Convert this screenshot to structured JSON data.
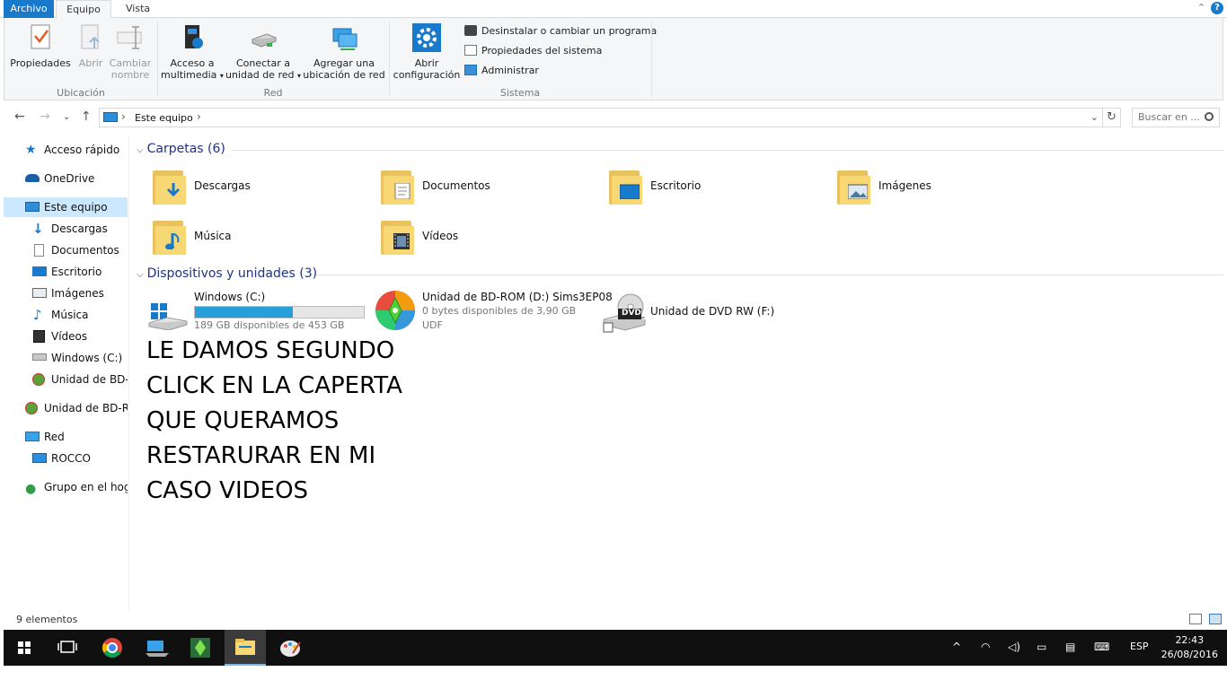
{
  "ribbon_tabs": {
    "file": "Archivo",
    "computer": "Equipo",
    "view": "Vista"
  },
  "ribbon": {
    "location": {
      "label": "Ubicación",
      "properties": "Propiedades",
      "open": "Abrir",
      "rename_1": "Cambiar",
      "rename_2": "nombre"
    },
    "network": {
      "label": "Red",
      "media_1": "Acceso a",
      "media_2": "multimedia",
      "map_1": "Conectar a",
      "map_2": "unidad de red",
      "add_1": "Agregar una",
      "add_2": "ubicación de red"
    },
    "system": {
      "label": "Sistema",
      "settings_1": "Abrir",
      "settings_2": "configuración",
      "uninstall": "Desinstalar o cambiar un programa",
      "sys_props": "Propiedades del sistema",
      "manage": "Administrar"
    }
  },
  "address": {
    "path": "Este equipo",
    "search_placeholder": "Buscar en ..."
  },
  "sidebar": {
    "items": [
      {
        "label": "Acceso rápido"
      },
      {
        "label": "OneDrive"
      },
      {
        "label": "Este equipo"
      },
      {
        "label": "Descargas"
      },
      {
        "label": "Documentos"
      },
      {
        "label": "Escritorio"
      },
      {
        "label": "Imágenes"
      },
      {
        "label": "Música"
      },
      {
        "label": "Vídeos"
      },
      {
        "label": "Windows (C:)"
      },
      {
        "label": "Unidad de BD-R"
      },
      {
        "label": "Unidad de BD-RO"
      },
      {
        "label": "Red"
      },
      {
        "label": "ROCCO"
      },
      {
        "label": "Grupo en el hoga"
      }
    ]
  },
  "folders": {
    "header": "Carpetas (6)",
    "items": [
      {
        "label": "Descargas"
      },
      {
        "label": "Documentos"
      },
      {
        "label": "Escritorio"
      },
      {
        "label": "Imágenes"
      },
      {
        "label": "Música"
      },
      {
        "label": "Vídeos"
      }
    ]
  },
  "devices": {
    "header": "Dispositivos y unidades (3)",
    "items": [
      {
        "name": "Windows (C:)",
        "free": "189 GB disponibles de 453 GB",
        "used_fraction": 0.58
      },
      {
        "name": "Unidad de BD-ROM (D:) Sims3EP08",
        "free": "0 bytes disponibles de 3,90 GB",
        "fs": "UDF"
      },
      {
        "name": "Unidad de DVD RW (F:)"
      }
    ]
  },
  "overlay_text": "LE DAMOS SEGUNDO CLICK EN LA CAPERTA QUE QUERAMOS RESTARURAR EN MI CASO VIDEOS",
  "status": {
    "count": "9 elementos"
  },
  "taskbar": {
    "lang": "ESP",
    "time": "22:43",
    "date": "26/08/2016"
  },
  "colors": {
    "accent": "#1979ca",
    "folder": "#f8d775",
    "selection": "#cce8ff",
    "drive_bar": "#26a0da"
  }
}
